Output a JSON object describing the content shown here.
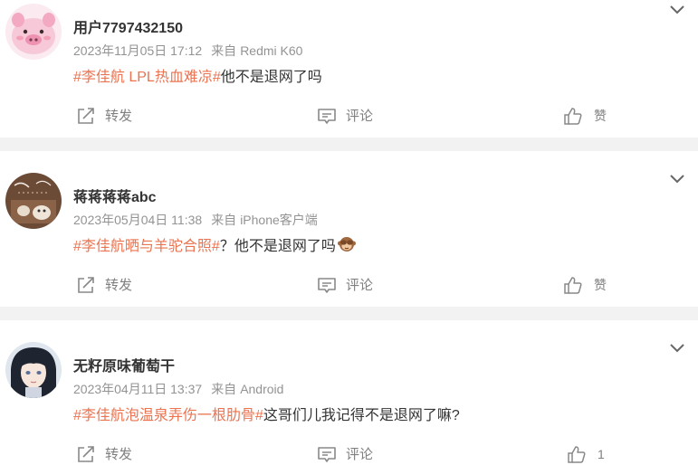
{
  "posts": [
    {
      "username": "用户7797432150",
      "date": "2023年11月05日 17:12",
      "source_label": "来自",
      "source_device": "Redmi K60",
      "topic": "#李佳航 LPL热血难凉#",
      "text": "他不是退网了吗",
      "emoji": "",
      "repost_label": "转发",
      "comment_label": "评论",
      "like_label": "赞",
      "avatar": "pink-pig-avatar"
    },
    {
      "username": "蒋蒋蒋蒋abc",
      "date": "2023年05月04日 11:38",
      "source_label": "来自",
      "source_device": "iPhone客户端",
      "topic": "#李佳航晒与羊驼合照#",
      "text": "？他不是退网了吗",
      "emoji": "see-no-evil-monkey",
      "repost_label": "转发",
      "comment_label": "评论",
      "like_label": "赞",
      "avatar": "brown-doodle-avatar"
    },
    {
      "username": "无籽原味葡萄干",
      "date": "2023年04月11日 13:37",
      "source_label": "来自",
      "source_device": "Android",
      "topic": "#李佳航泡温泉弄伤一根肋骨#",
      "text": "这哥们儿我记得不是退网了嘛?",
      "emoji": "",
      "repost_label": "转发",
      "comment_label": "评论",
      "like_label": "1",
      "avatar": "anime-character-avatar"
    }
  ],
  "icons": {
    "more": "chevron-down-icon",
    "repost": "share-arrow-icon",
    "comment": "comment-bubble-icon",
    "like": "thumbs-up-icon"
  },
  "colors": {
    "topic": "#eb7350",
    "text": "#333333",
    "meta": "#939393",
    "background": "#f2f2f2"
  }
}
